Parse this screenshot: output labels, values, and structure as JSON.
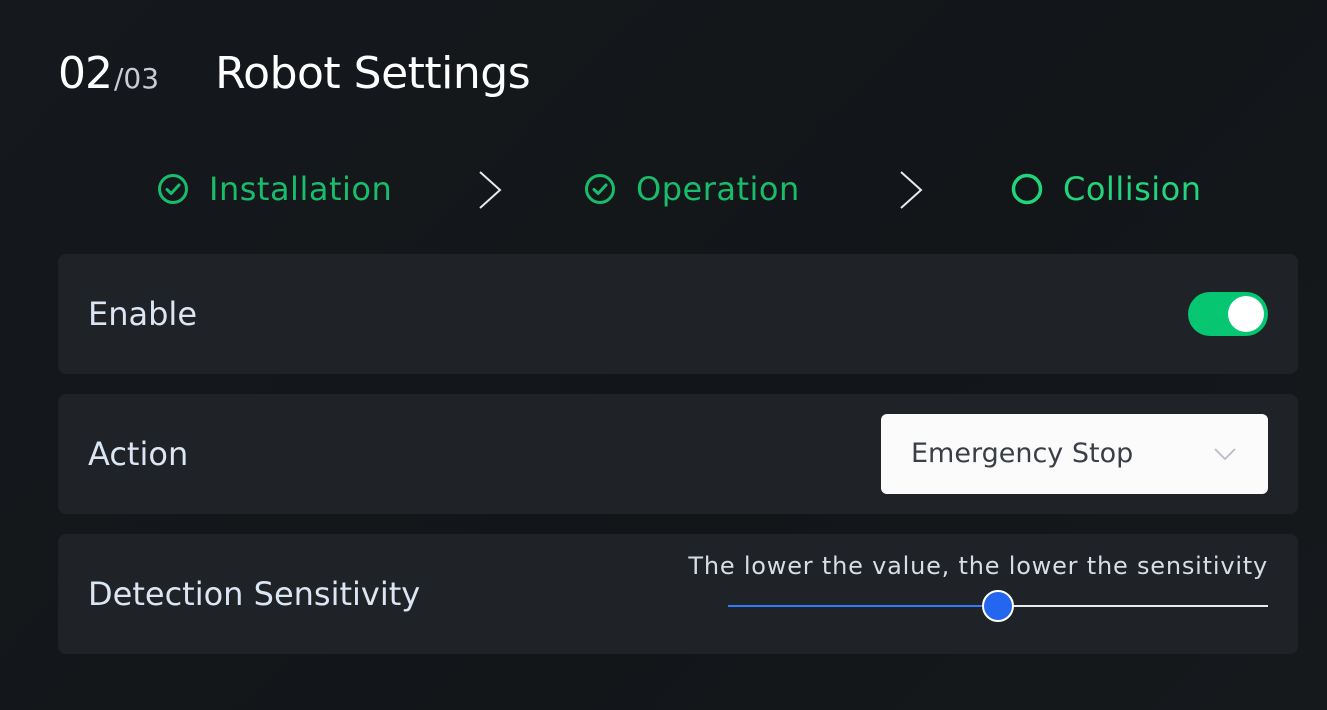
{
  "header": {
    "step_current": "02",
    "step_total": "/03",
    "title": "Robot Settings"
  },
  "stepper": {
    "steps": [
      {
        "label": "Installation",
        "status": "completed",
        "icon": "check-circle-icon"
      },
      {
        "label": "Operation",
        "status": "completed",
        "icon": "check-circle-icon"
      },
      {
        "label": "Collision",
        "status": "current",
        "icon": "circle-icon"
      }
    ],
    "separator_icon": "chevron-right-icon"
  },
  "settings": {
    "enable": {
      "label": "Enable",
      "value": true
    },
    "action": {
      "label": "Action",
      "selected": "Emergency Stop",
      "icon": "chevron-down-icon"
    },
    "sensitivity": {
      "label": "Detection Sensitivity",
      "hint": "The lower the value, the lower the sensitivity",
      "value_fraction": 0.5
    }
  },
  "colors": {
    "background": "#131719",
    "panel": "#1f2327",
    "accent_green": "#06c672",
    "step_green": "#19bc6b",
    "slider_blue": "#2466f0"
  }
}
